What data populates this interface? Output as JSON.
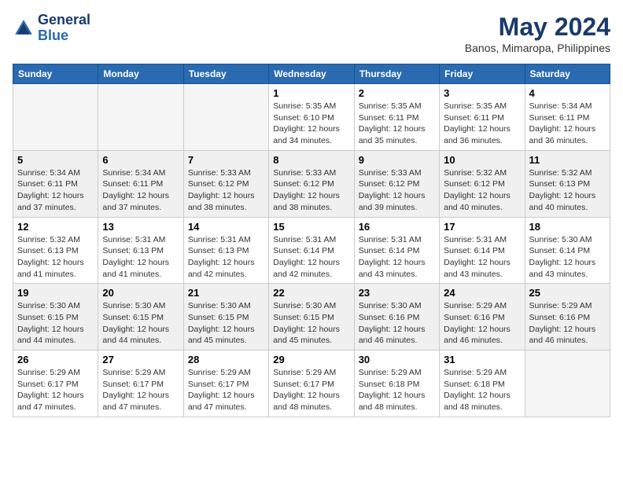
{
  "header": {
    "logo_line1": "General",
    "logo_line2": "Blue",
    "month_year": "May 2024",
    "location": "Banos, Mimaropa, Philippines"
  },
  "days_of_week": [
    "Sunday",
    "Monday",
    "Tuesday",
    "Wednesday",
    "Thursday",
    "Friday",
    "Saturday"
  ],
  "weeks": [
    {
      "shaded": false,
      "days": [
        {
          "num": "",
          "info": ""
        },
        {
          "num": "",
          "info": ""
        },
        {
          "num": "",
          "info": ""
        },
        {
          "num": "1",
          "info": "Sunrise: 5:35 AM\nSunset: 6:10 PM\nDaylight: 12 hours\nand 34 minutes."
        },
        {
          "num": "2",
          "info": "Sunrise: 5:35 AM\nSunset: 6:11 PM\nDaylight: 12 hours\nand 35 minutes."
        },
        {
          "num": "3",
          "info": "Sunrise: 5:35 AM\nSunset: 6:11 PM\nDaylight: 12 hours\nand 36 minutes."
        },
        {
          "num": "4",
          "info": "Sunrise: 5:34 AM\nSunset: 6:11 PM\nDaylight: 12 hours\nand 36 minutes."
        }
      ]
    },
    {
      "shaded": true,
      "days": [
        {
          "num": "5",
          "info": "Sunrise: 5:34 AM\nSunset: 6:11 PM\nDaylight: 12 hours\nand 37 minutes."
        },
        {
          "num": "6",
          "info": "Sunrise: 5:34 AM\nSunset: 6:11 PM\nDaylight: 12 hours\nand 37 minutes."
        },
        {
          "num": "7",
          "info": "Sunrise: 5:33 AM\nSunset: 6:12 PM\nDaylight: 12 hours\nand 38 minutes."
        },
        {
          "num": "8",
          "info": "Sunrise: 5:33 AM\nSunset: 6:12 PM\nDaylight: 12 hours\nand 38 minutes."
        },
        {
          "num": "9",
          "info": "Sunrise: 5:33 AM\nSunset: 6:12 PM\nDaylight: 12 hours\nand 39 minutes."
        },
        {
          "num": "10",
          "info": "Sunrise: 5:32 AM\nSunset: 6:12 PM\nDaylight: 12 hours\nand 40 minutes."
        },
        {
          "num": "11",
          "info": "Sunrise: 5:32 AM\nSunset: 6:13 PM\nDaylight: 12 hours\nand 40 minutes."
        }
      ]
    },
    {
      "shaded": false,
      "days": [
        {
          "num": "12",
          "info": "Sunrise: 5:32 AM\nSunset: 6:13 PM\nDaylight: 12 hours\nand 41 minutes."
        },
        {
          "num": "13",
          "info": "Sunrise: 5:31 AM\nSunset: 6:13 PM\nDaylight: 12 hours\nand 41 minutes."
        },
        {
          "num": "14",
          "info": "Sunrise: 5:31 AM\nSunset: 6:13 PM\nDaylight: 12 hours\nand 42 minutes."
        },
        {
          "num": "15",
          "info": "Sunrise: 5:31 AM\nSunset: 6:14 PM\nDaylight: 12 hours\nand 42 minutes."
        },
        {
          "num": "16",
          "info": "Sunrise: 5:31 AM\nSunset: 6:14 PM\nDaylight: 12 hours\nand 43 minutes."
        },
        {
          "num": "17",
          "info": "Sunrise: 5:31 AM\nSunset: 6:14 PM\nDaylight: 12 hours\nand 43 minutes."
        },
        {
          "num": "18",
          "info": "Sunrise: 5:30 AM\nSunset: 6:14 PM\nDaylight: 12 hours\nand 43 minutes."
        }
      ]
    },
    {
      "shaded": true,
      "days": [
        {
          "num": "19",
          "info": "Sunrise: 5:30 AM\nSunset: 6:15 PM\nDaylight: 12 hours\nand 44 minutes."
        },
        {
          "num": "20",
          "info": "Sunrise: 5:30 AM\nSunset: 6:15 PM\nDaylight: 12 hours\nand 44 minutes."
        },
        {
          "num": "21",
          "info": "Sunrise: 5:30 AM\nSunset: 6:15 PM\nDaylight: 12 hours\nand 45 minutes."
        },
        {
          "num": "22",
          "info": "Sunrise: 5:30 AM\nSunset: 6:15 PM\nDaylight: 12 hours\nand 45 minutes."
        },
        {
          "num": "23",
          "info": "Sunrise: 5:30 AM\nSunset: 6:16 PM\nDaylight: 12 hours\nand 46 minutes."
        },
        {
          "num": "24",
          "info": "Sunrise: 5:29 AM\nSunset: 6:16 PM\nDaylight: 12 hours\nand 46 minutes."
        },
        {
          "num": "25",
          "info": "Sunrise: 5:29 AM\nSunset: 6:16 PM\nDaylight: 12 hours\nand 46 minutes."
        }
      ]
    },
    {
      "shaded": false,
      "days": [
        {
          "num": "26",
          "info": "Sunrise: 5:29 AM\nSunset: 6:17 PM\nDaylight: 12 hours\nand 47 minutes."
        },
        {
          "num": "27",
          "info": "Sunrise: 5:29 AM\nSunset: 6:17 PM\nDaylight: 12 hours\nand 47 minutes."
        },
        {
          "num": "28",
          "info": "Sunrise: 5:29 AM\nSunset: 6:17 PM\nDaylight: 12 hours\nand 47 minutes."
        },
        {
          "num": "29",
          "info": "Sunrise: 5:29 AM\nSunset: 6:17 PM\nDaylight: 12 hours\nand 48 minutes."
        },
        {
          "num": "30",
          "info": "Sunrise: 5:29 AM\nSunset: 6:18 PM\nDaylight: 12 hours\nand 48 minutes."
        },
        {
          "num": "31",
          "info": "Sunrise: 5:29 AM\nSunset: 6:18 PM\nDaylight: 12 hours\nand 48 minutes."
        },
        {
          "num": "",
          "info": ""
        }
      ]
    }
  ]
}
